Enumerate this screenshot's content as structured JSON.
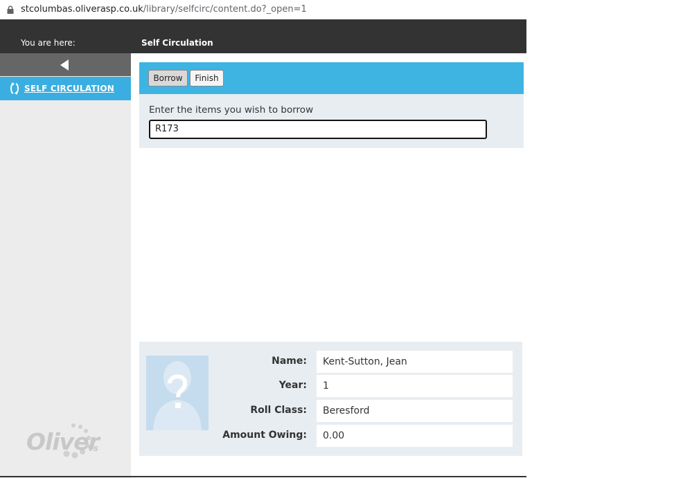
{
  "browser": {
    "url_host": "stcolumbas.oliverasp.co.uk",
    "url_path": "/library/selfcirc/content.do?_open=1"
  },
  "header": {
    "you_are_here": "You are here:",
    "breadcrumb": "Self Circulation"
  },
  "sidebar": {
    "items": [
      {
        "label": "SELF CIRCULATION",
        "icon": "self-circulation-icon",
        "active": true
      }
    ],
    "logo_text": "Oliver",
    "logo_suffix": "vs"
  },
  "toolbar": {
    "borrow_label": "Borrow",
    "finish_label": "Finish"
  },
  "borrow": {
    "prompt": "Enter the items you wish to borrow",
    "input_value": "R173"
  },
  "patron": {
    "fields": [
      {
        "label": "Name:",
        "value": "Kent-Sutton, Jean"
      },
      {
        "label": "Year:",
        "value": "1"
      },
      {
        "label": "Roll Class:",
        "value": "Beresford"
      },
      {
        "label": "Amount Owing:",
        "value": "0.00"
      }
    ]
  },
  "colors": {
    "accent": "#3eb4e3",
    "header": "#333333",
    "panel": "#e8edf1"
  }
}
